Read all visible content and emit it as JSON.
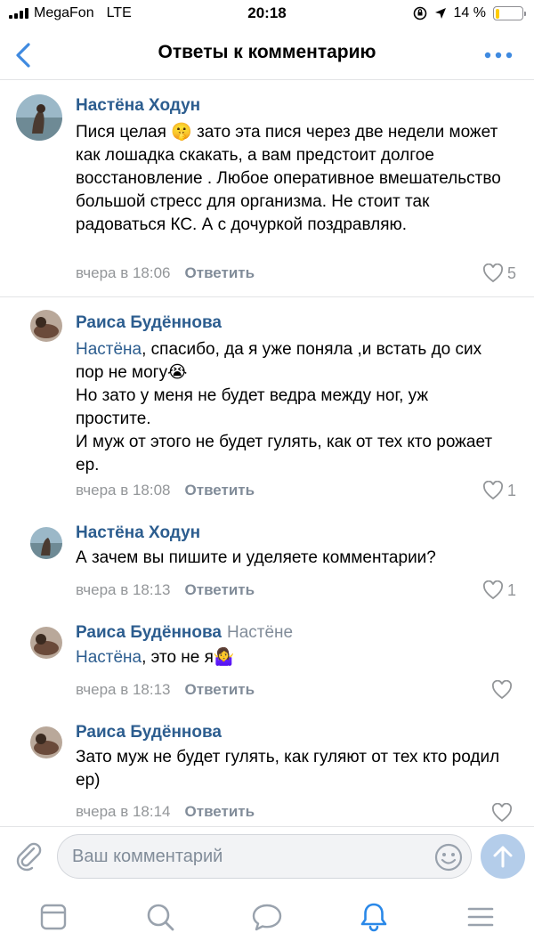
{
  "status_bar": {
    "carrier": "MegaFon",
    "network": "LTE",
    "time": "20:18",
    "battery_text": "14 %",
    "battery_level": 0.14,
    "battery_color": "#ffcc00"
  },
  "header": {
    "title": "Ответы к комментарию",
    "back_icon": "chevron-left-icon",
    "more_icon": "more-horizontal-icon"
  },
  "comments": [
    {
      "author": "Настёна Ходун",
      "text": "Пися целая 🤫 зато эта пися через две недели может как лошадка скакать, а вам предстоит долгое восстановление . Любое оперативное вмешательство большой стресс для организма. Не стоит так радоваться КС. А с дочуркой поздравляю.",
      "time": "вчера в 18:06",
      "reply_label": "Ответить",
      "likes": "5"
    },
    {
      "author": "Раиса Будённова",
      "mention": "Настёна",
      "text": ", спасибо, да я уже поняла ,и  встать до сих пор не могу😭\nНо зато у меня не будет ведра между ног, уж простите.\nИ муж от этого не будет гулять, как от тех кто рожает ер.",
      "time": "вчера в 18:08",
      "reply_label": "Ответить",
      "likes": "1"
    },
    {
      "author": "Настёна Ходун",
      "text": "А зачем вы пишите и уделяете комментарии?",
      "time": "вчера в 18:13",
      "reply_label": "Ответить",
      "likes": "1"
    },
    {
      "author": "Раиса Будённова",
      "reply_to": "Настёне",
      "mention": "Настёна",
      "text": ", это не я🤷‍♀️",
      "time": "вчера в 18:13",
      "reply_label": "Ответить",
      "likes": ""
    },
    {
      "author": "Раиса Будённова",
      "text": "Зато муж не будет гулять, как гуляют от тех кто родил ер)",
      "time": "вчера в 18:14",
      "reply_label": "Ответить",
      "likes": ""
    }
  ],
  "composer": {
    "placeholder": "Ваш комментарий",
    "attach_icon": "paperclip-icon",
    "emoji_icon": "smiley-icon",
    "send_icon": "arrow-up-icon",
    "send_color": "#b4cdea"
  },
  "tabbar": {
    "items": [
      "news-icon",
      "search-icon",
      "messages-icon",
      "notifications-icon",
      "menu-icon"
    ],
    "active": "notifications-icon",
    "accent": "#2a88e8"
  },
  "colors": {
    "link": "#2c5d8f",
    "secondary": "#939699",
    "header_accent": "#3f8ae0"
  }
}
